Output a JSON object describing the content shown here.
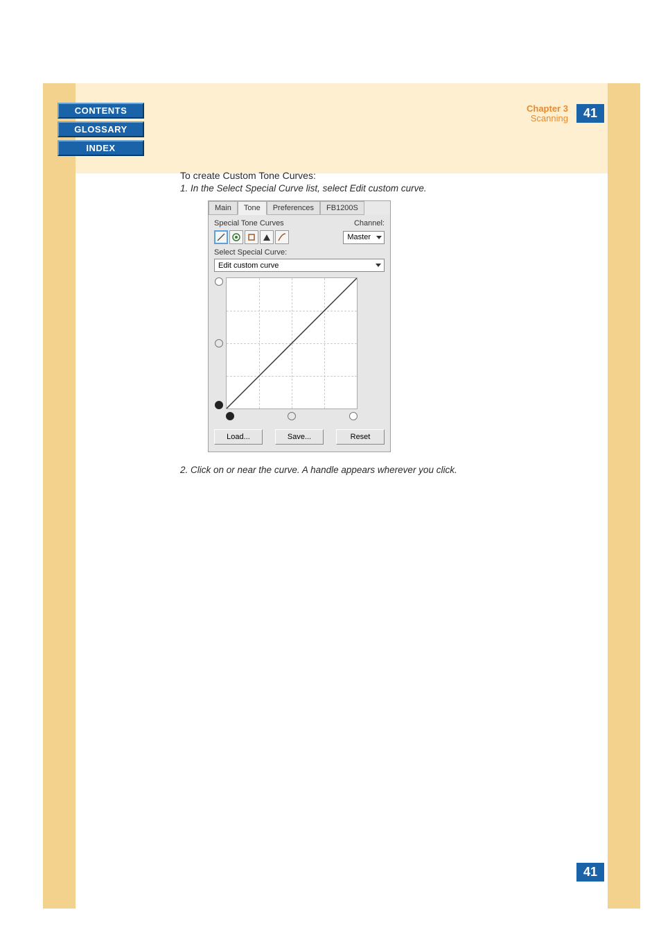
{
  "nav": {
    "contents": "CONTENTS",
    "glossary": "GLOSSARY",
    "index": "INDEX"
  },
  "header": {
    "chapter_title": "Chapter 3",
    "chapter_sub": "Scanning",
    "page_number": "41"
  },
  "body": {
    "heading": "To create Custom Tone Curves:",
    "step1": "1.  In the Select Special Curve list, select Edit custom curve.",
    "step2": "2.  Click on or near the curve. A handle appears wherever you click."
  },
  "dialog": {
    "tabs": {
      "main": "Main",
      "tone": "Tone",
      "preferences": "Preferences",
      "model": "FB1200S"
    },
    "special_tone_curves_label": "Special Tone Curves",
    "channel_label": "Channel:",
    "channel_value": "Master",
    "select_special_curve_label": "Select Special Curve:",
    "curve_value": "Edit custom curve",
    "buttons": {
      "load": "Load...",
      "save": "Save...",
      "reset": "Reset"
    },
    "icons": {
      "no_correction": "no-correction-icon",
      "auto": "auto-icon",
      "brightness": "brightness-icon",
      "contrast": "contrast-icon",
      "custom": "custom-curve-icon"
    }
  },
  "footer": {
    "page_number": "41"
  }
}
